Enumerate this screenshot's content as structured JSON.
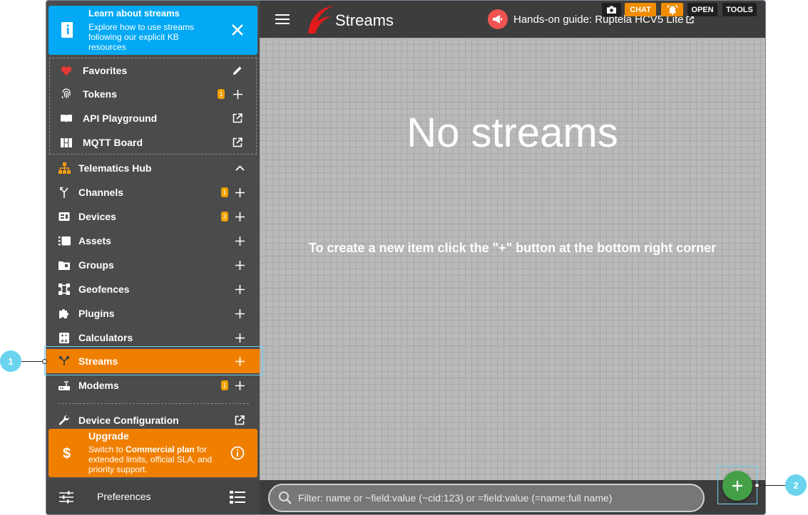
{
  "sidebar": {
    "info_banner": {
      "title": "Learn about streams",
      "text": "Explore how to use streams following our explicit KB resources"
    },
    "favorites": [
      {
        "label": "Favorites",
        "icon": "heart-icon",
        "action": "edit-icon"
      },
      {
        "label": "Tokens",
        "icon": "fingerprint-icon",
        "badge": "1",
        "action": "plus-icon"
      },
      {
        "label": "API Playground",
        "icon": "book-icon",
        "action": "open-external-icon"
      },
      {
        "label": "MQTT Board",
        "icon": "board-icon",
        "action": "open-external-icon"
      }
    ],
    "section": {
      "label": "Telematics Hub",
      "icon": "hierarchy-icon",
      "action": "chevron-up-icon"
    },
    "items": [
      {
        "label": "Channels",
        "icon": "merge-icon",
        "badge": "1"
      },
      {
        "label": "Devices",
        "icon": "device-icon",
        "badge": "3"
      },
      {
        "label": "Assets",
        "icon": "asset-icon"
      },
      {
        "label": "Groups",
        "icon": "folder-icon"
      },
      {
        "label": "Geofences",
        "icon": "geofence-icon"
      },
      {
        "label": "Plugins",
        "icon": "puzzle-icon"
      },
      {
        "label": "Calculators",
        "icon": "calculator-icon"
      },
      {
        "label": "Streams",
        "icon": "stream-icon",
        "active": true
      },
      {
        "label": "Modems",
        "icon": "modem-icon",
        "badge": "1"
      }
    ],
    "device_config": {
      "label": "Device Configuration",
      "icon": "wrench-icon"
    },
    "upgrade": {
      "title": "Upgrade",
      "text_before": "Switch to ",
      "text_bold": "Commercial plan",
      "text_after": " for extended limits, official SLA, and priority support.",
      "icon_symbol": "$"
    },
    "preferences_label": "Preferences"
  },
  "header": {
    "title": "Streams",
    "guide_label": "Hands-on guide: Ruptela HCV5 Lite",
    "buttons": {
      "chat": "CHAT",
      "open": "OPEN",
      "tools": "TOOLS"
    }
  },
  "main": {
    "empty_title": "No streams",
    "empty_hint": "To create a new item click the \"+\" button at the bottom right corner"
  },
  "filter": {
    "placeholder": "Filter: name or ~field:value (~cid:123) or =field:value (=name:full name)"
  },
  "callouts": [
    "1",
    "2"
  ],
  "colors": {
    "accent_orange": "#f07f00",
    "info_blue": "#03a9f4",
    "fab_green": "#43a047",
    "callout_cyan": "#6ad4ee"
  }
}
